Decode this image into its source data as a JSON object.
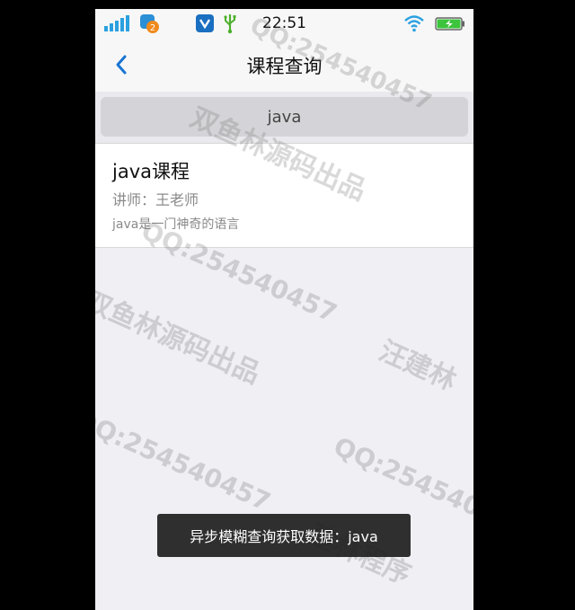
{
  "status_bar": {
    "time": "22:51",
    "badge_count": "2"
  },
  "nav": {
    "title": "课程查询"
  },
  "search": {
    "value": "java"
  },
  "results": [
    {
      "title": "java课程",
      "teacher": "讲师：王老师",
      "description": "java是一门神奇的语言"
    }
  ],
  "toast": {
    "message": "异步模糊查询获取数据：java"
  },
  "watermarks": {
    "text_a": "双鱼林源码出品",
    "text_b": "QQ:254540457",
    "text_c": "汪建林",
    "text_d": "建林程序"
  },
  "colors": {
    "accent": "#1a74d2",
    "signal": "#2aa0e0",
    "battery": "#3cc43c"
  }
}
